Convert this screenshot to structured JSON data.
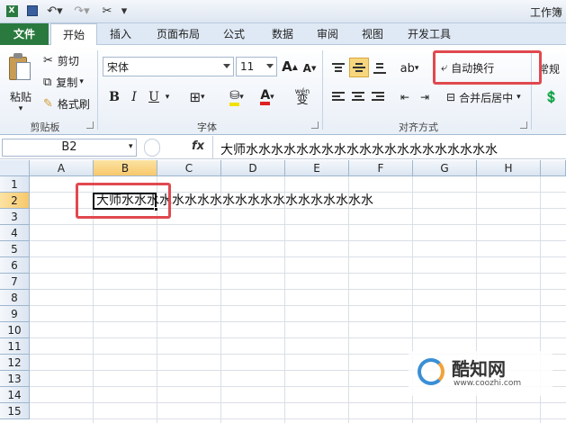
{
  "app": {
    "title": "工作簿"
  },
  "quick_access": {
    "save_icon": "save-icon",
    "undo_icon": "undo-icon",
    "redo_icon": "redo-icon",
    "customize_icon": "customize-icon"
  },
  "tabs": [
    {
      "label": "文件"
    },
    {
      "label": "开始"
    },
    {
      "label": "插入"
    },
    {
      "label": "页面布局"
    },
    {
      "label": "公式"
    },
    {
      "label": "数据"
    },
    {
      "label": "审阅"
    },
    {
      "label": "视图"
    },
    {
      "label": "开发工具"
    }
  ],
  "ribbon": {
    "clipboard": {
      "paste": "粘贴",
      "cut": "剪切",
      "copy": "复制",
      "format_painter": "格式刷",
      "group_label": "剪贴板"
    },
    "font": {
      "font_name": "宋体",
      "font_size": "11",
      "increase": "A",
      "decrease": "A",
      "bold": "B",
      "italic": "I",
      "underline": "U",
      "font_color_letter": "A",
      "wen_label": "wén",
      "wen_char": "变",
      "group_label": "字体"
    },
    "alignment": {
      "wrap_text": "自动换行",
      "merge_center": "合并后居中",
      "group_label": "对齐方式"
    },
    "number": {
      "format": "常规"
    }
  },
  "formula_bar": {
    "name_box": "B2",
    "fx_label": "fx",
    "content": "大师水水水水水水水水水水水水水水水水水水水水"
  },
  "sheet": {
    "columns": [
      "A",
      "B",
      "C",
      "D",
      "E",
      "F",
      "G",
      "H"
    ],
    "rows": [
      "1",
      "2",
      "3",
      "4",
      "5",
      "6",
      "7",
      "8",
      "9",
      "10",
      "11",
      "12",
      "13",
      "14",
      "15"
    ],
    "active_cell": "B2",
    "cell_b2_text": "大师水水水水水水水水水水水水水水水水水水水水"
  },
  "watermark": {
    "title": "酷知网",
    "url": "www.coozhi.com"
  },
  "colors": {
    "file_tab": "#2a7a3f",
    "highlight_box": "#e0494f",
    "selected_header": "#f8c86b"
  }
}
